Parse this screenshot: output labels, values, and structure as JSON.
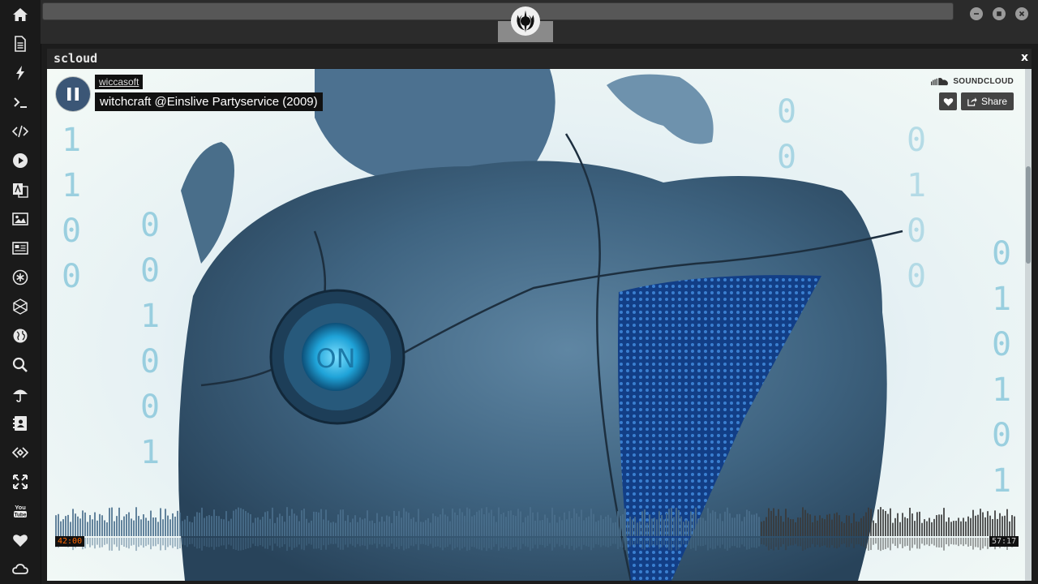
{
  "sidebar": {
    "icons": [
      "home-icon",
      "document-icon",
      "lightning-icon",
      "terminal-icon",
      "code-icon",
      "play-circle-icon",
      "translate-icon",
      "image-icon",
      "newspaper-icon",
      "asterisk-icon",
      "hexagon-icon",
      "globe-icon",
      "search-icon",
      "umbrella-icon",
      "contacts-icon",
      "code-brackets-icon",
      "expand-icon",
      "youtube-icon",
      "heart-icon",
      "cloud-icon"
    ]
  },
  "topbar": {
    "logo_icon": "rebel-alliance-icon",
    "window_controls": [
      "minimize-icon",
      "maximize-icon",
      "close-icon"
    ]
  },
  "window": {
    "title": "scloud",
    "close_label": "x"
  },
  "player": {
    "artist": "wiccasoft",
    "track": "witchcraft @Einslive Partyservice (2009)",
    "brand": "SOUNDCLOUD",
    "share_label": "Share",
    "time_current": "42:00",
    "time_total": "57:17",
    "progress": 0.733,
    "state": "playing"
  },
  "artwork": {
    "binary_columns": [
      "1\n1\n0\n0",
      "0\n0\n1\n0\n0\n1",
      "0\n1\n0\n0",
      "0\n0",
      "0\n1\n0\n1\n0\n1"
    ],
    "button_text": "ON"
  },
  "colors": {
    "accent": "#ff6600",
    "played": "#4a6f8c",
    "unplayed": "#3a3a3a",
    "play_button": "#3b5676"
  }
}
